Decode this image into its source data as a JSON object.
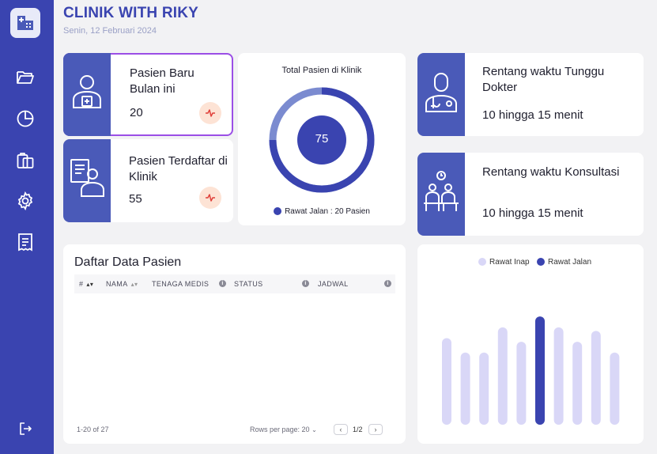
{
  "app": {
    "title": "CLINIK WITH RIKY",
    "date": "Senin, 12 Februari 2024"
  },
  "sidebar": {
    "items": [
      {
        "icon": "folder-icon"
      },
      {
        "icon": "pie-chart-icon"
      },
      {
        "icon": "clipboard-icon"
      },
      {
        "icon": "gear-icon"
      },
      {
        "icon": "receipt-icon"
      },
      {
        "icon": "logout-icon"
      }
    ]
  },
  "cards": {
    "new_patients": {
      "title": "Pasien Baru Bulan ini",
      "value": "20",
      "icon": "patient-plus-icon"
    },
    "registered": {
      "title": "Pasien Terdaftar di Klinik",
      "value": "55",
      "icon": "patient-list-icon"
    },
    "wait_time": {
      "title": "Rentang waktu Tunggu Dokter",
      "value": "10 hingga 15 menit",
      "icon": "doctor-icon"
    },
    "consult_time": {
      "title": "Rentang waktu Konsultasi",
      "value": "10 hingga 15 menit",
      "icon": "waiting-room-icon"
    }
  },
  "donut": {
    "title": "Total Pasien di Klinik",
    "center_value": "75",
    "legend": "Rawat Jalan : 20 Pasien",
    "colors": {
      "main": "#3a44b0",
      "light": "#7b8bd0",
      "center": "#3a44b0"
    }
  },
  "table": {
    "title": "Daftar Data Pasien",
    "columns": [
      "#",
      "NAMA",
      "TENAGA MEDIS",
      "STATUS",
      "JADWAL"
    ],
    "range_text": "1-20 of 27",
    "rows_per_page_label": "Rows per page: 20",
    "page_text": "1/2",
    "prev": "‹",
    "next": "›"
  },
  "chart_data": {
    "type": "bar",
    "series": [
      {
        "name": "Rawat Inap",
        "color": "#d9d7f7"
      },
      {
        "name": "Rawat Jalan",
        "color": "#3a44b0"
      }
    ],
    "values": [
      12,
      10,
      10,
      13.5,
      11.5,
      15,
      13.5,
      11.5,
      13,
      10
    ],
    "highlight_index": 5,
    "ylim": [
      0,
      16
    ]
  }
}
